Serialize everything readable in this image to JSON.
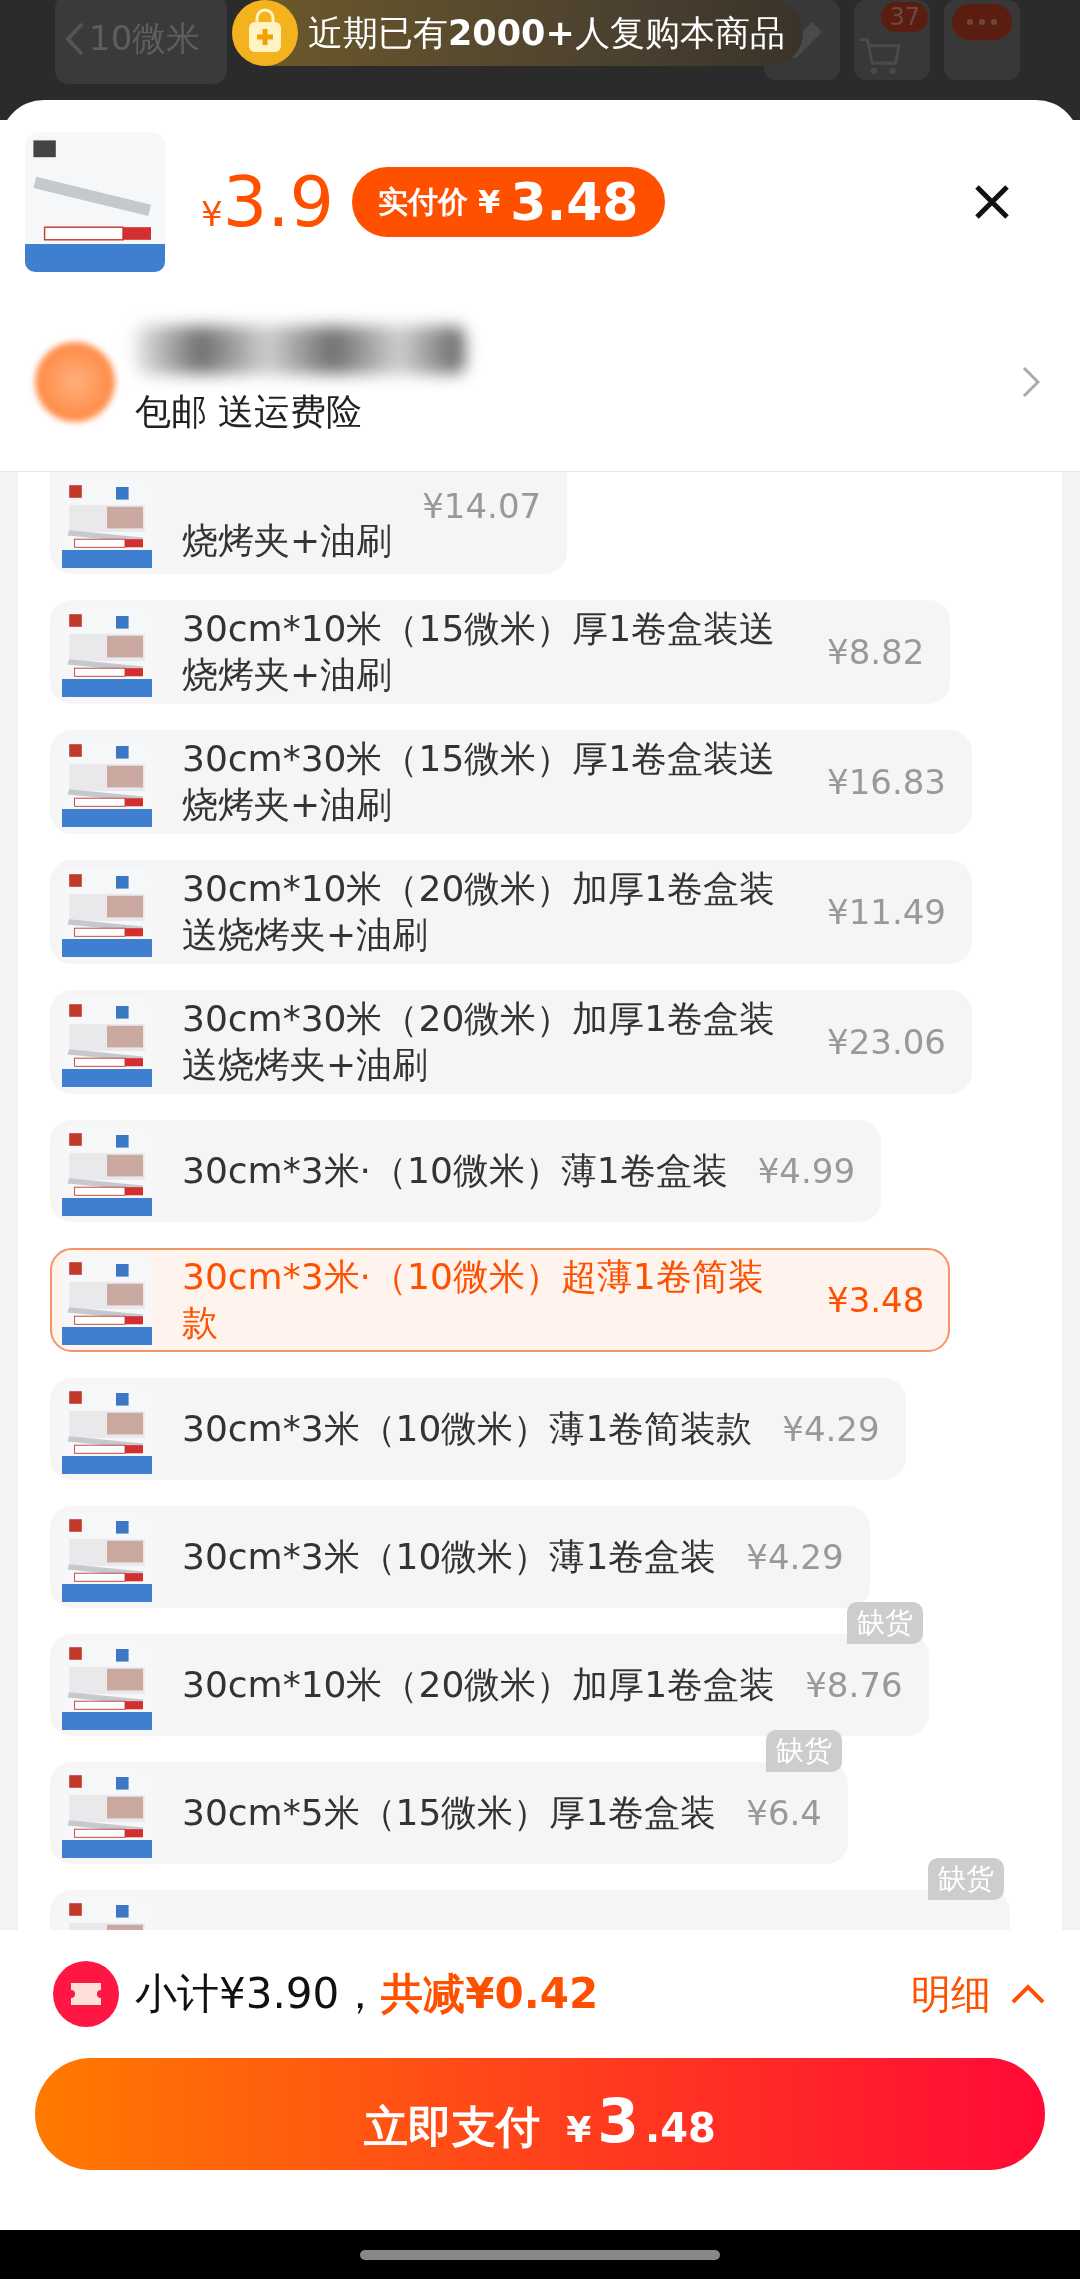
{
  "top_bar": {
    "back_label": "10微米",
    "cart_count": "37",
    "banner": "近期已有**2000+**人复购本商品"
  },
  "header": {
    "currency": "¥",
    "amount": "3.9",
    "paid_badge": {
      "label": "实付价",
      "currency": "¥",
      "amount": "3.48"
    },
    "shop_tags": "包邮 送运费险"
  },
  "items": [
    {
      "kind": "cut-top",
      "name": "烧烤夹+油刷",
      "price": "¥14.07",
      "selected": false
    },
    {
      "kind": "full",
      "name": "30cm*10米（15微米）厚1卷盒装送烧烤夹+油刷",
      "price": "¥8.82",
      "selected": false
    },
    {
      "kind": "full",
      "name": "30cm*30米（15微米）厚1卷盒装送烧烤夹+油刷",
      "price": "¥16.83",
      "selected": false
    },
    {
      "kind": "full",
      "name": "30cm*10米（20微米）加厚1卷盒装送烧烤夹+油刷",
      "price": "¥11.49",
      "selected": false
    },
    {
      "kind": "full",
      "name": "30cm*30米（20微米）加厚1卷盒装送烧烤夹+油刷",
      "price": "¥23.06",
      "selected": false
    },
    {
      "kind": "full",
      "name": "30cm*3米·（10微米）薄1卷盒装",
      "price": "¥4.99",
      "selected": false
    },
    {
      "kind": "full",
      "name": "30cm*3米·（10微米）超薄1卷简装款",
      "price": "¥3.48",
      "selected": true
    },
    {
      "kind": "full",
      "name": "30cm*3米（10微米）薄1卷简装款",
      "price": "¥4.29",
      "selected": false
    },
    {
      "kind": "full",
      "name": "30cm*3米（10微米）薄1卷盒装",
      "price": "¥4.29",
      "selected": false
    },
    {
      "kind": "full",
      "name": "30cm*10米（20微米）加厚1卷盒装",
      "price": "¥8.76",
      "selected": false,
      "badge": "缺货"
    },
    {
      "kind": "full",
      "name": "30cm*5米（15微米）厚1卷盒装",
      "price": "¥6.4",
      "selected": false,
      "badge": "缺货"
    },
    {
      "kind": "cut-bottom",
      "selected": false,
      "badge": "缺货"
    }
  ],
  "summary": {
    "subtotal": "小计¥3.90，",
    "discount": "共减¥0.42",
    "details": "明细"
  },
  "pay_button": {
    "label": "立即支付",
    "currency": "¥",
    "integer": "3",
    "decimal": ".48"
  }
}
